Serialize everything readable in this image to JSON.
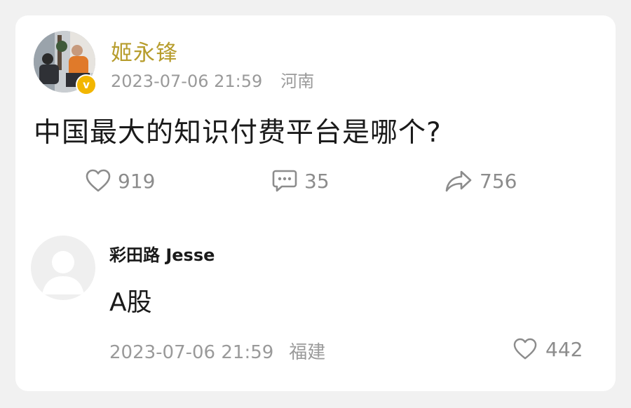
{
  "post": {
    "author": "姬永锋",
    "verified_badge": "v",
    "timestamp": "2023-07-06 21:59",
    "location": "河南",
    "content": "中国最大的知识付费平台是哪个?",
    "actions": {
      "likes": "919",
      "comments": "35",
      "reposts": "756"
    }
  },
  "comment": {
    "author": "彩田路 Jesse",
    "text": "A股",
    "timestamp": "2023-07-06 21:59",
    "location": "福建",
    "likes": "442"
  },
  "colors": {
    "author_name": "#b79d2d",
    "verified_badge": "#f2b600",
    "meta_text": "#9a9a9a",
    "icon": "#8c8c8c"
  },
  "icons": [
    "heart-icon",
    "comment-icon",
    "share-icon",
    "verified-icon"
  ]
}
